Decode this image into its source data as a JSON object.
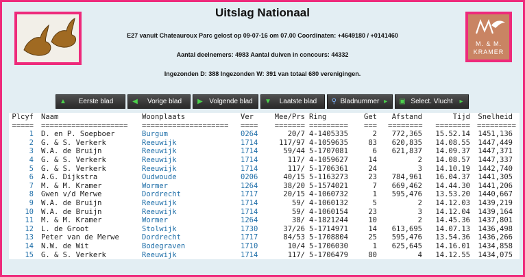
{
  "page": {
    "title": "Uitslag Nationaal",
    "line1": "E27 vanuit Chateauroux Parc gelost op 09-07-16 om 07.00 Coordinaten: +4649180 / +0141460",
    "line2": "Aantal deelnemers: 4983 Aantal duiven in concours: 44332",
    "line3": "Ingezonden D: 388 Ingezonden W: 391 van totaal 680 verenigingen."
  },
  "logos": {
    "left_icon": "pigeons-icon",
    "right_line1": "M. & M.",
    "right_line2": "KRAMER",
    "right_icon": "bird-logo-icon"
  },
  "colors": {
    "frame": "#ee2a7b",
    "background": "#e3eef3",
    "link": "#1e6ea8"
  },
  "toolbar": [
    {
      "label": "Eerste blad",
      "icon": "arrow-up-icon"
    },
    {
      "label": "Vorige blad",
      "icon": "arrow-left-icon"
    },
    {
      "label": "Volgende blad",
      "icon": "arrow-right-icon"
    },
    {
      "label": "Laatste blad",
      "icon": "arrow-down-icon"
    },
    {
      "label": "Bladnummer",
      "icon": "search-icon"
    },
    {
      "label": "Select. Vlucht",
      "icon": "select-icon"
    }
  ],
  "table": {
    "headers": [
      "Plcyf",
      "Naam",
      "Woonplaats",
      "Ver",
      "Mee/Prs",
      "Ring",
      "Get",
      "Afstand",
      "Tijd",
      "Snelheid"
    ],
    "underlines": [
      "=====",
      "====================",
      "====================",
      "====",
      "=======",
      "=========",
      "===",
      "========",
      "========",
      "========="
    ],
    "rows": [
      [
        "1",
        "D. en P. Soepboer",
        "Burgum",
        "0264",
        "20/7",
        "4-1405335",
        "2",
        "772,365",
        "15.52.14",
        "1451,136"
      ],
      [
        "2",
        "G. & S. Verkerk",
        "Reeuwijk",
        "1714",
        "117/97",
        "4-1059635",
        "83",
        "620,835",
        "14.08.55",
        "1447,449"
      ],
      [
        "3",
        "W.A. de Bruijn",
        "Reeuwijk",
        "1714",
        "59/44",
        "5-1707081",
        "6",
        "621,837",
        "14.09.37",
        "1447,371"
      ],
      [
        "4",
        "G. & S. Verkerk",
        "Reeuwijk",
        "1714",
        "117/",
        "4-1059627",
        "14",
        "2",
        "14.08.57",
        "1447,337"
      ],
      [
        "5",
        "G. & S. Verkerk",
        "Reeuwijk",
        "1714",
        "117/",
        "5-1706361",
        "24",
        "3",
        "14.10.19",
        "1442,740"
      ],
      [
        "6",
        "A.G. Dijkstra",
        "Oudwoude",
        "0206",
        "40/15",
        "5-1163273",
        "23",
        "784,961",
        "16.04.37",
        "1441,305"
      ],
      [
        "7",
        "M. & M. Kramer",
        "Wormer",
        "1264",
        "38/20",
        "5-1574021",
        "7",
        "669,462",
        "14.44.30",
        "1441,206"
      ],
      [
        "8",
        "Gwen v/d Merwe",
        "Dordrecht",
        "1717",
        "20/15",
        "4-1060732",
        "1",
        "595,476",
        "13.53.20",
        "1440,667"
      ],
      [
        "9",
        "W.A. de Bruijn",
        "Reeuwijk",
        "1714",
        "59/",
        "4-1060132",
        "5",
        "2",
        "14.12.03",
        "1439,219"
      ],
      [
        "10",
        "W.A. de Bruijn",
        "Reeuwijk",
        "1714",
        "59/",
        "4-1060154",
        "23",
        "3",
        "14.12.04",
        "1439,164"
      ],
      [
        "11",
        "M. & M. Kramer",
        "Wormer",
        "1264",
        "38/",
        "4-1821244",
        "10",
        "2",
        "14.45.36",
        "1437,801"
      ],
      [
        "12",
        "L. de Groot",
        "Stolwijk",
        "1730",
        "37/26",
        "5-1714971",
        "14",
        "613,695",
        "14.07.13",
        "1436,498"
      ],
      [
        "13",
        "Peter van de Merwe",
        "Dordrecht",
        "1717",
        "84/53",
        "5-1708804",
        "25",
        "595,476",
        "13.54.36",
        "1436,266"
      ],
      [
        "14",
        "N.W. de Wit",
        "Bodegraven",
        "1710",
        "10/4",
        "5-1706030",
        "1",
        "625,645",
        "14.16.01",
        "1434,858"
      ],
      [
        "15",
        "G. & S. Verkerk",
        "Reeuwijk",
        "1714",
        "117/",
        "5-1706479",
        "80",
        "4",
        "14.12.55",
        "1434,075"
      ]
    ]
  }
}
